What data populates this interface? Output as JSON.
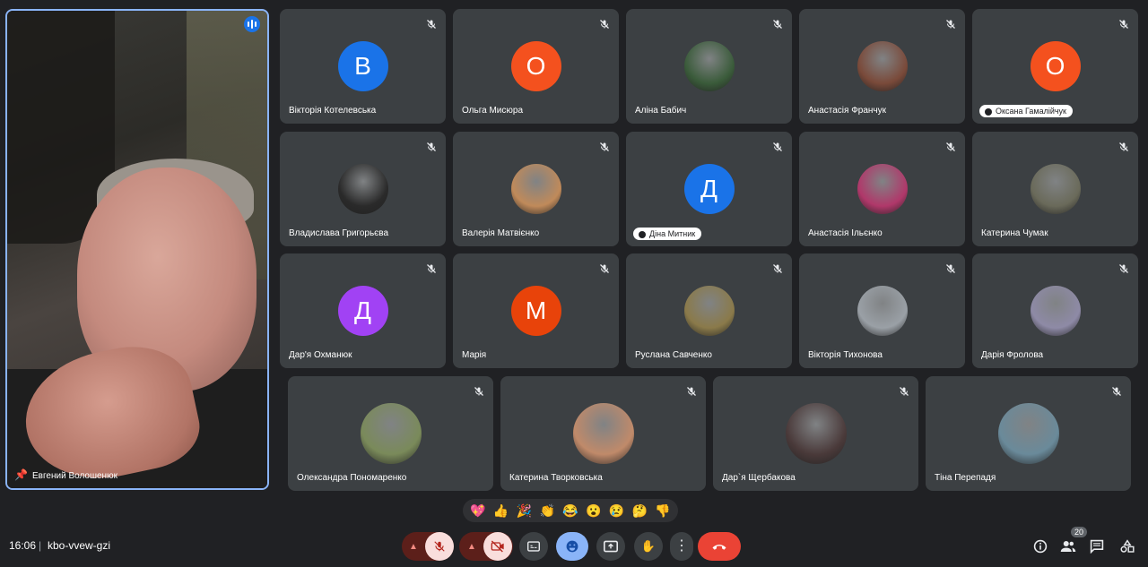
{
  "speaker": {
    "name": "Евгений Волошенюк"
  },
  "participants": [
    {
      "name": "Вікторія Котелевська",
      "initial": "В",
      "color": "#1a73e8",
      "style": "plain"
    },
    {
      "name": "Ольга Мисюра",
      "initial": "О",
      "color": "#f4511e",
      "style": "plain"
    },
    {
      "name": "Аліна Бабич",
      "initial": "",
      "color": "#3a5b3a",
      "style": "plain"
    },
    {
      "name": "Анастасія Франчук",
      "initial": "",
      "color": "#7a4a3a",
      "style": "plain"
    },
    {
      "name": "Оксана Гамалійчук",
      "initial": "О",
      "color": "#f4511e",
      "style": "pill"
    },
    {
      "name": "Владислава Григорьєва",
      "initial": "",
      "color": "#2a2a2a",
      "style": "plain"
    },
    {
      "name": "Валерія Матвієнко",
      "initial": "",
      "color": "#c08a5a",
      "style": "plain"
    },
    {
      "name": "Діна Митник",
      "initial": "Д",
      "color": "#1a73e8",
      "style": "pill"
    },
    {
      "name": "Анастасія Ільєнко",
      "initial": "",
      "color": "#b0386a",
      "style": "plain"
    },
    {
      "name": "Катерина Чумак",
      "initial": "",
      "color": "#6a6a5a",
      "style": "plain"
    },
    {
      "name": "Дар'я Охманюк",
      "initial": "Д",
      "color": "#a142f4",
      "style": "plain"
    },
    {
      "name": "Марія",
      "initial": "М",
      "color": "#e8430a",
      "style": "plain"
    },
    {
      "name": "Руслана Савченко",
      "initial": "",
      "color": "#8a7a4a",
      "style": "plain"
    },
    {
      "name": "Вікторія Тихонова",
      "initial": "",
      "color": "#9aa0a6",
      "style": "plain"
    },
    {
      "name": "Дарія Фролова",
      "initial": "",
      "color": "#8e8aa6",
      "style": "plain"
    },
    {
      "name": "Олександра Пономаренко",
      "initial": "",
      "color": "#7a8a5a",
      "style": "plain"
    },
    {
      "name": "Катерина Творковська",
      "initial": "",
      "color": "#c08a6a",
      "style": "plain"
    },
    {
      "name": "Дар`я Щербакова",
      "initial": "",
      "color": "#4a3a3a",
      "style": "plain"
    },
    {
      "name": "Тіна Перепадя",
      "initial": "",
      "color": "#6a8a9a",
      "style": "plain"
    }
  ],
  "reactions": [
    "💖",
    "👍",
    "🎉",
    "👏",
    "😂",
    "😮",
    "😢",
    "🤔",
    "👎"
  ],
  "footer": {
    "time": "16:06",
    "separator": "|",
    "meeting_code": "kbo-vvew-gzi",
    "participant_count": "20"
  }
}
